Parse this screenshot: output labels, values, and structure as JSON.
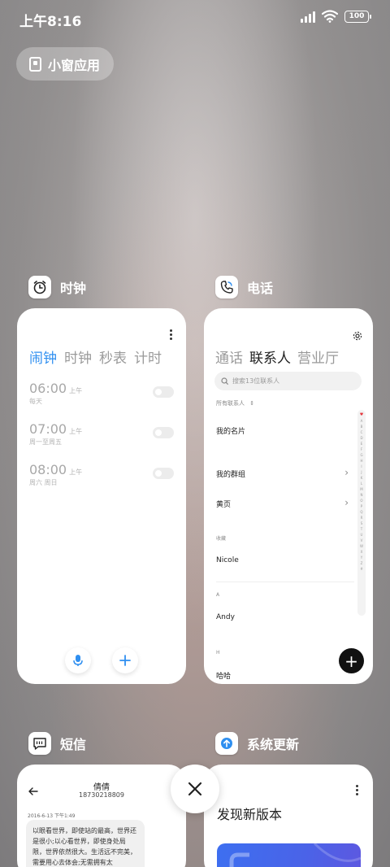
{
  "status_bar": {
    "time": "上午8:16",
    "battery": "100"
  },
  "floating_window": {
    "label": "小窗应用"
  },
  "apps": {
    "clock": {
      "title": "时钟",
      "tabs": [
        "闹钟",
        "时钟",
        "秒表",
        "计时"
      ],
      "alarms": [
        {
          "time": "06:00",
          "ampm": "上午",
          "repeat": "每天"
        },
        {
          "time": "07:00",
          "ampm": "上午",
          "repeat": "周一至周五"
        },
        {
          "time": "08:00",
          "ampm": "上午",
          "repeat": "周六 周日"
        }
      ]
    },
    "phone": {
      "title": "电话",
      "tabs": [
        "通话",
        "联系人",
        "营业厅"
      ],
      "search_placeholder": "搜索13位联系人",
      "all_contacts_label": "所有联系人",
      "my_card": "我的名片",
      "my_groups": "我的群组",
      "yellow_pages": "黄页",
      "favorites_label": "收藏",
      "favorite_contact": "Nicole",
      "section_a": "A",
      "contact_a": "Andy",
      "section_h": "H",
      "contact_h": "哈哈",
      "alphabet": [
        "A",
        "B",
        "C",
        "D",
        "E",
        "F",
        "G",
        "H",
        "I",
        "J",
        "K",
        "L",
        "M",
        "N",
        "O",
        "P",
        "Q",
        "R",
        "S",
        "T",
        "U",
        "V",
        "W",
        "X",
        "Y",
        "Z",
        "#"
      ]
    },
    "sms": {
      "title": "短信",
      "contact_name": "倩倩",
      "contact_number": "18730218809",
      "date": "2016-6-13 下午1:49",
      "message": "以眼看世界，即使站的最高，世界还是很小;以心看世界，即使身处局限，世界依然很大。生活远不完美，需要用心去体会;无需拥有太"
    },
    "update": {
      "title": "系统更新",
      "headline": "发现新版本"
    }
  },
  "colors": {
    "accent_blue": "#2f8ff0",
    "fab_black": "#111111",
    "favorite_red": "#e4383e"
  }
}
